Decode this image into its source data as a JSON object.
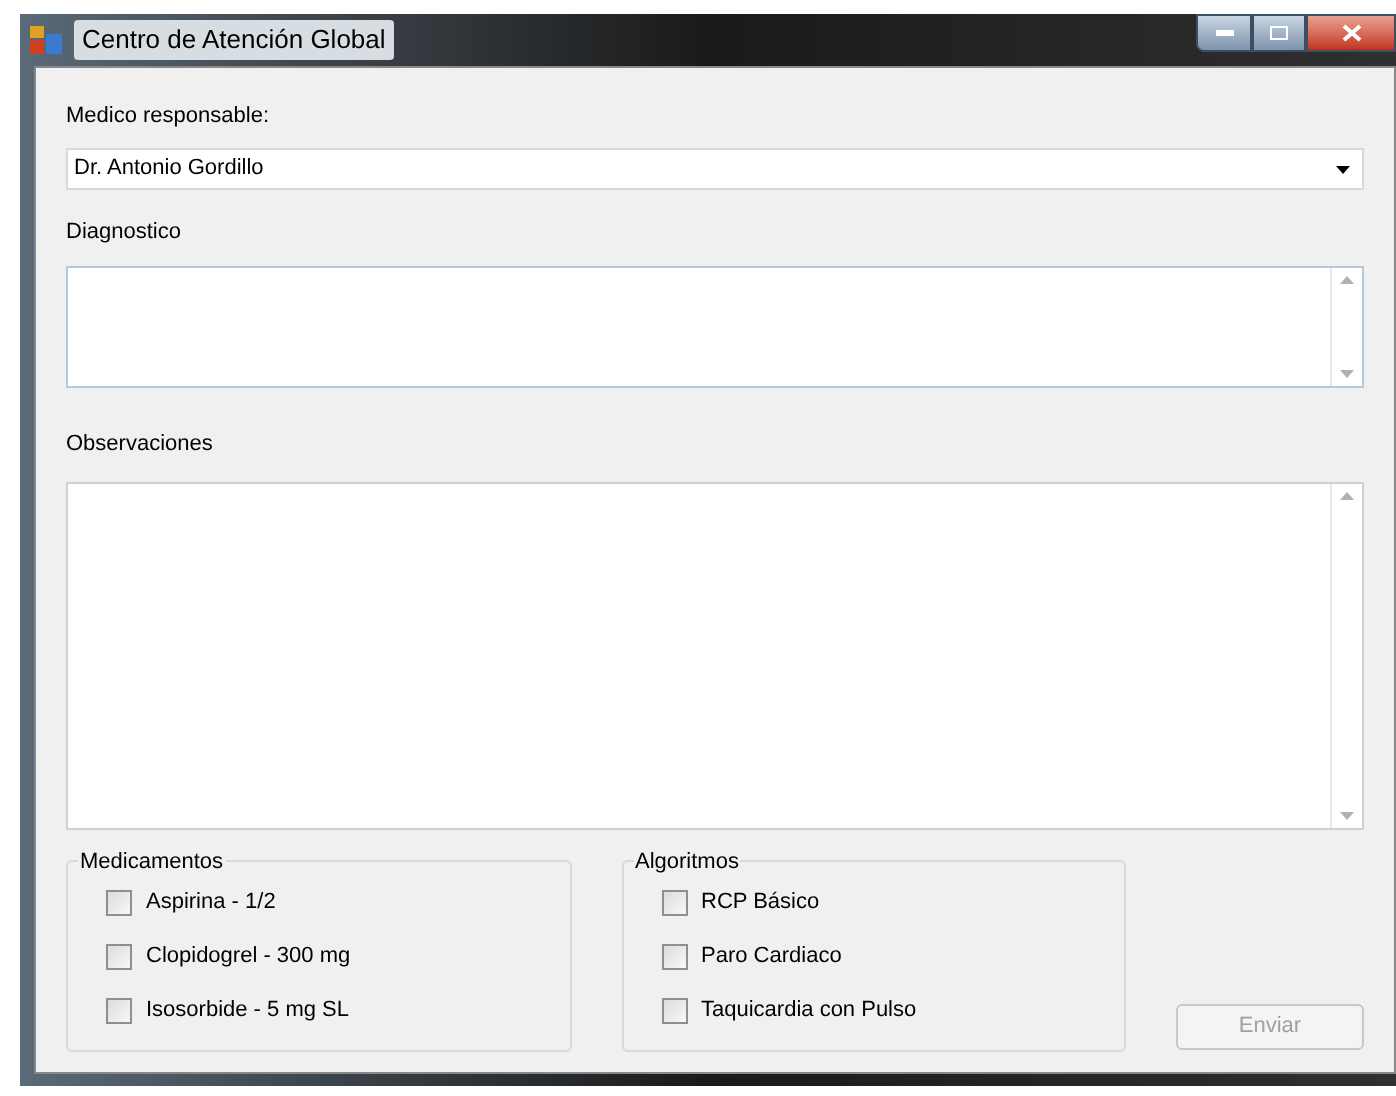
{
  "window": {
    "title": "Centro de Atención Global"
  },
  "doctor": {
    "label": "Medico responsable:",
    "value": "Dr. Antonio Gordillo"
  },
  "diagnosis": {
    "label": "Diagnostico"
  },
  "observations": {
    "label": "Observaciones"
  },
  "groups": [
    {
      "title": "Medicamentos",
      "items": [
        {
          "label": "Aspirina - 1/2",
          "checked": false
        },
        {
          "label": "Clopidogrel - 300 mg",
          "checked": false
        },
        {
          "label": "Isosorbide - 5 mg SL",
          "checked": false
        }
      ]
    },
    {
      "title": "Algoritmos",
      "items": [
        {
          "label": "RCP Básico",
          "checked": false
        },
        {
          "label": "Paro Cardiaco",
          "checked": false
        },
        {
          "label": "Taquicardia con Pulso",
          "checked": false
        }
      ]
    }
  ],
  "submit": {
    "label": "Enviar",
    "disabled": true
  }
}
